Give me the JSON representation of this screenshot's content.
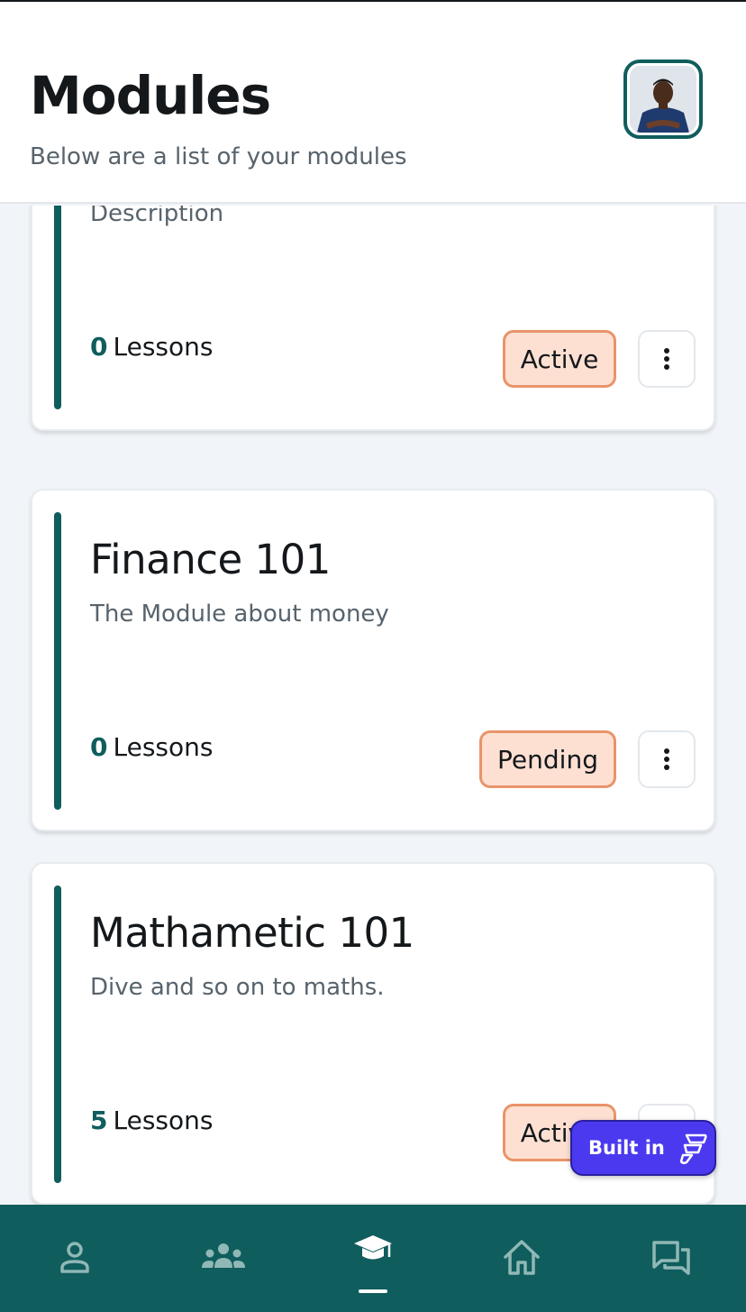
{
  "header": {
    "title": "Modules",
    "subtitle": "Below are a list of your modules",
    "avatar_icon": "user-avatar"
  },
  "modules": [
    {
      "title": "",
      "description": "Description",
      "lesson_count": "0",
      "lessons_label": "Lessons",
      "status": "Active"
    },
    {
      "title": "Finance 101",
      "description": "The Module about money",
      "lesson_count": "0",
      "lessons_label": "Lessons",
      "status": "Pending"
    },
    {
      "title": "Mathametic 101",
      "description": "Dive and so on to maths.",
      "lesson_count": "5",
      "lessons_label": "Lessons",
      "status": "Active"
    }
  ],
  "bottom_nav": {
    "items": [
      "profile-icon",
      "group-icon",
      "graduation-cap-icon",
      "home-icon",
      "chat-icon"
    ],
    "active_index": 2
  },
  "badge": {
    "label": "Built in"
  },
  "colors": {
    "primary": "#105d5d",
    "status_bg": "#fde0d2",
    "status_border": "#e8946a",
    "built_in_bg": "#4b39ef"
  }
}
